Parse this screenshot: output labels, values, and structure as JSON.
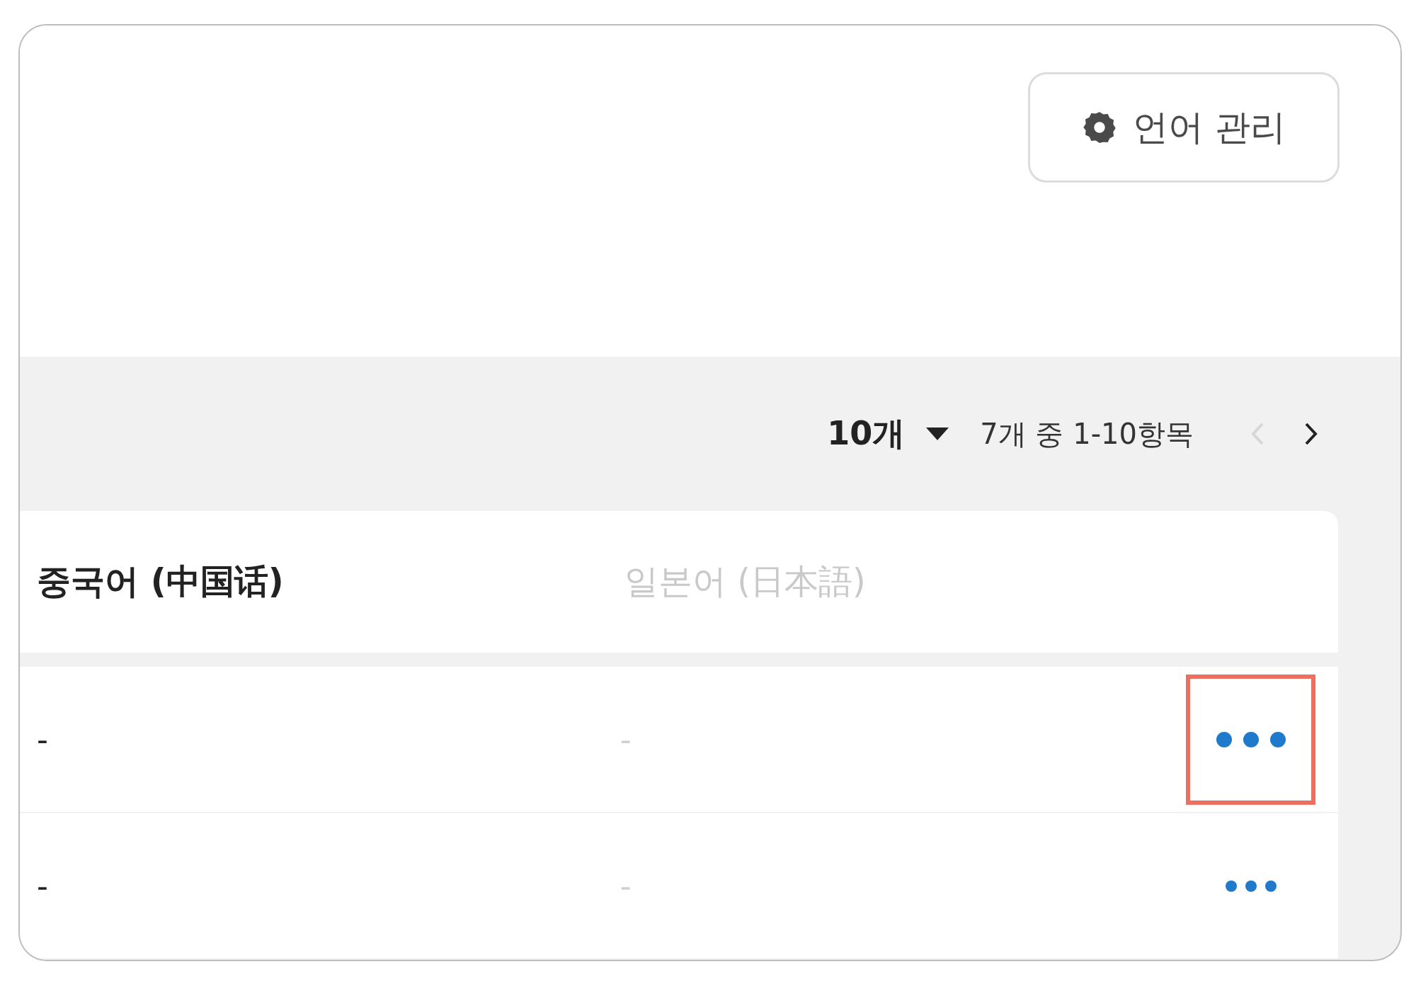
{
  "toolbar": {
    "manage_button": {
      "label": "언어 관리"
    }
  },
  "pagination": {
    "page_size": "10개",
    "range": "7개 중 1-10항목",
    "prev_disabled": true,
    "next_disabled": false
  },
  "table": {
    "columns": [
      {
        "label": "중국어 (中国话)",
        "disabled": false
      },
      {
        "label": "일본어 (日本語)",
        "disabled": true
      }
    ],
    "rows": [
      {
        "cells": [
          "-",
          "-"
        ],
        "highlighted": true
      },
      {
        "cells": [
          "-",
          "-"
        ],
        "highlighted": false
      }
    ]
  }
}
